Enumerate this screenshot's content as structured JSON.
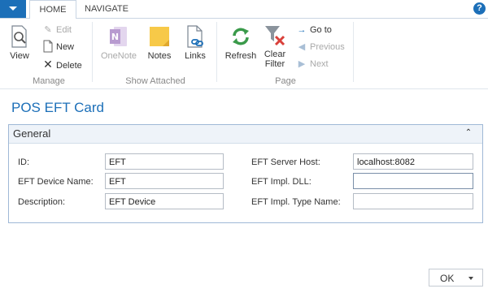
{
  "tabs": {
    "home": "HOME",
    "navigate": "NAVIGATE"
  },
  "help_label": "?",
  "ribbon": {
    "manage": {
      "label": "Manage",
      "view": "View",
      "edit": "Edit",
      "new": "New",
      "delete": "Delete"
    },
    "show_attached": {
      "label": "Show Attached",
      "onenote": "OneNote",
      "notes": "Notes",
      "links": "Links"
    },
    "page": {
      "label": "Page",
      "refresh": "Refresh",
      "clear_filter_line1": "Clear",
      "clear_filter_line2": "Filter",
      "go_to": "Go to",
      "previous": "Previous",
      "next": "Next"
    }
  },
  "page_title": "POS EFT Card",
  "general": {
    "title": "General",
    "collapse_glyph": "⌃",
    "fields": {
      "id_label": "ID:",
      "id_value": "EFT",
      "device_name_label": "EFT Device Name:",
      "device_name_value": "EFT",
      "description_label": "Description:",
      "description_value": "EFT Device",
      "server_host_label": "EFT Server Host:",
      "server_host_value": "localhost:8082",
      "impl_dll_label": "EFT Impl. DLL:",
      "impl_dll_value": "",
      "impl_type_label": "EFT Impl. Type Name:",
      "impl_type_value": ""
    }
  },
  "ok_label": "OK",
  "colors": {
    "accent": "#1c6fb8",
    "refresh_green": "#3a9a4a",
    "clear_filter_red": "#d9403a",
    "notes_yellow": "#f7c948",
    "onenote_purple": "#b89bd0"
  }
}
